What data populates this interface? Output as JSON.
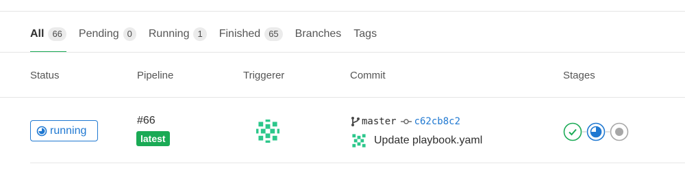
{
  "tabs": [
    {
      "label": "All",
      "count": "66"
    },
    {
      "label": "Pending",
      "count": "0"
    },
    {
      "label": "Running",
      "count": "1"
    },
    {
      "label": "Finished",
      "count": "65"
    },
    {
      "label": "Branches"
    },
    {
      "label": "Tags"
    }
  ],
  "table": {
    "headers": {
      "status": "Status",
      "pipeline": "Pipeline",
      "triggerer": "Triggerer",
      "commit": "Commit",
      "stages": "Stages"
    },
    "rows": [
      {
        "status": "running",
        "pipeline_id": "#66",
        "badge": "latest",
        "branch": "master",
        "sha": "c62cb8c2",
        "message": "Update playbook.yaml",
        "stages": [
          "success",
          "running",
          "created"
        ]
      }
    ]
  },
  "colors": {
    "success": "#1aaa55",
    "running": "#1f78d1",
    "created": "#a7a7a7"
  },
  "icons": [
    "status-running-icon",
    "identicon-avatar",
    "branch-icon",
    "commit-icon",
    "stage-success-icon",
    "stage-running-icon",
    "stage-created-icon"
  ]
}
